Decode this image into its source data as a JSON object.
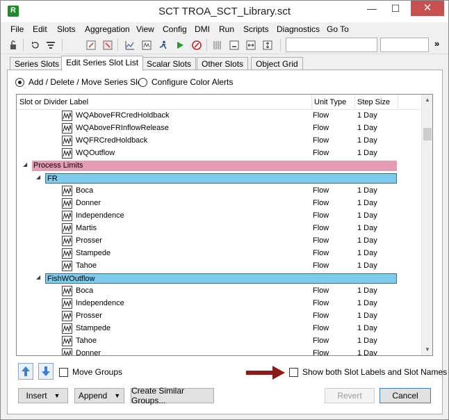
{
  "window": {
    "title": "SCT TROA_SCT_Library.sct",
    "min": "—",
    "max": "☐",
    "close": "✕"
  },
  "menu": [
    "File",
    "Edit",
    "Slots",
    "Aggregation",
    "View",
    "Config",
    "DMI",
    "Run",
    "Scripts",
    "Diagnostics",
    "Go To"
  ],
  "toolbar": {
    "field1_value": "",
    "field2_value": "",
    "overflow": "»"
  },
  "tabs": [
    {
      "label": "Series Slots",
      "active": false
    },
    {
      "label": "Edit Series Slot List",
      "active": true
    },
    {
      "label": "Scalar Slots",
      "active": false
    },
    {
      "label": "Other Slots",
      "active": false
    },
    {
      "label": "Object Grid",
      "active": false
    }
  ],
  "mode": {
    "option1": "Add / Delete / Move Series Slot",
    "option2": "Configure Color Alerts",
    "selected": "option1"
  },
  "grid": {
    "columns": {
      "label": "Slot or Divider Label",
      "unit": "Unit Type",
      "step": "Step Size"
    },
    "rows": [
      {
        "kind": "slot",
        "label": "WQAboveFRCredHoldback",
        "unit": "Flow",
        "step": "1 Day"
      },
      {
        "kind": "slot",
        "label": "WQAboveFRInflowRelease",
        "unit": "Flow",
        "step": "1 Day"
      },
      {
        "kind": "slot",
        "label": "WQFRCredHoldback",
        "unit": "Flow",
        "step": "1 Day"
      },
      {
        "kind": "slot",
        "label": "WQOutflow",
        "unit": "Flow",
        "step": "1 Day"
      },
      {
        "kind": "group1",
        "label": "Process Limits",
        "color": "#e59bb3"
      },
      {
        "kind": "group2",
        "label": "FR",
        "color": "#7ecbeb"
      },
      {
        "kind": "slot",
        "label": "Boca",
        "unit": "Flow",
        "step": "1 Day"
      },
      {
        "kind": "slot",
        "label": "Donner",
        "unit": "Flow",
        "step": "1 Day"
      },
      {
        "kind": "slot",
        "label": "Independence",
        "unit": "Flow",
        "step": "1 Day"
      },
      {
        "kind": "slot",
        "label": "Martis",
        "unit": "Flow",
        "step": "1 Day"
      },
      {
        "kind": "slot",
        "label": "Prosser",
        "unit": "Flow",
        "step": "1 Day"
      },
      {
        "kind": "slot",
        "label": "Stampede",
        "unit": "Flow",
        "step": "1 Day"
      },
      {
        "kind": "slot",
        "label": "Tahoe",
        "unit": "Flow",
        "step": "1 Day"
      },
      {
        "kind": "group2",
        "label": "FishWOutflow",
        "color": "#7ecbeb"
      },
      {
        "kind": "slot",
        "label": "Boca",
        "unit": "Flow",
        "step": "1 Day"
      },
      {
        "kind": "slot",
        "label": "Independence",
        "unit": "Flow",
        "step": "1 Day"
      },
      {
        "kind": "slot",
        "label": "Prosser",
        "unit": "Flow",
        "step": "1 Day"
      },
      {
        "kind": "slot",
        "label": "Stampede",
        "unit": "Flow",
        "step": "1 Day"
      },
      {
        "kind": "slot",
        "label": "Tahoe",
        "unit": "Flow",
        "step": "1 Day"
      },
      {
        "kind": "slot",
        "label": "Donner",
        "unit": "Flow",
        "step": "1 Day"
      }
    ]
  },
  "bottom": {
    "move_groups": "Move Groups",
    "show_both": "Show both Slot Labels and Slot Names",
    "insert": "Insert",
    "append": "Append",
    "create_similar": "Create Similar Groups...",
    "revert": "Revert",
    "cancel": "Cancel"
  },
  "colors": {
    "accent_arrow": "#8b1a1a",
    "move_button": "#3f7fcf"
  }
}
